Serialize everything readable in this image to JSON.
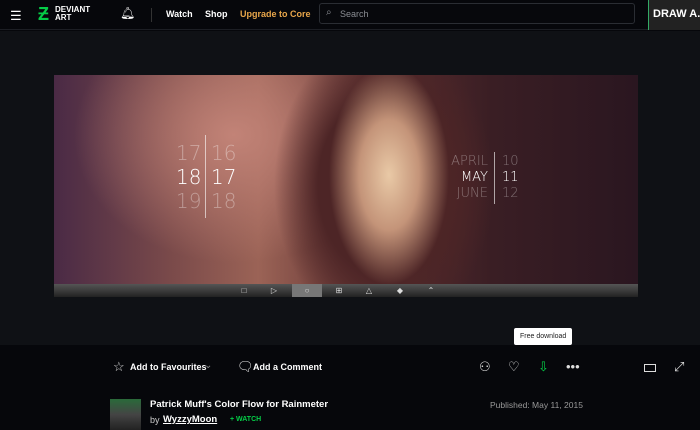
{
  "header": {
    "nav": [
      "Watch",
      "Shop"
    ],
    "upgrade": "Upgrade to Core",
    "search_placeholder": "Search",
    "logo": "DEVIANT ART",
    "user": "DRAW A..."
  },
  "art": {
    "left": {
      "col1": [
        "17",
        "18",
        "19"
      ],
      "col2": [
        "16",
        "17",
        "18"
      ]
    },
    "right": {
      "months": [
        "APRIL",
        "MAY",
        "JUNE"
      ],
      "days": [
        "10",
        "11",
        "12"
      ]
    }
  },
  "actions": {
    "favourite": "Add to Favourites",
    "comment": "Add a Comment",
    "tooltip": "Free download"
  },
  "deviation": {
    "title": "Patrick Muff's Color Flow for Rainmeter",
    "by": "by",
    "author": "WyzzyMoon",
    "watch": "+ WATCH",
    "published": "Published: May 11, 2015"
  },
  "colors": {
    "accent": "#05cc47",
    "upgrade": "#e8a64a"
  }
}
